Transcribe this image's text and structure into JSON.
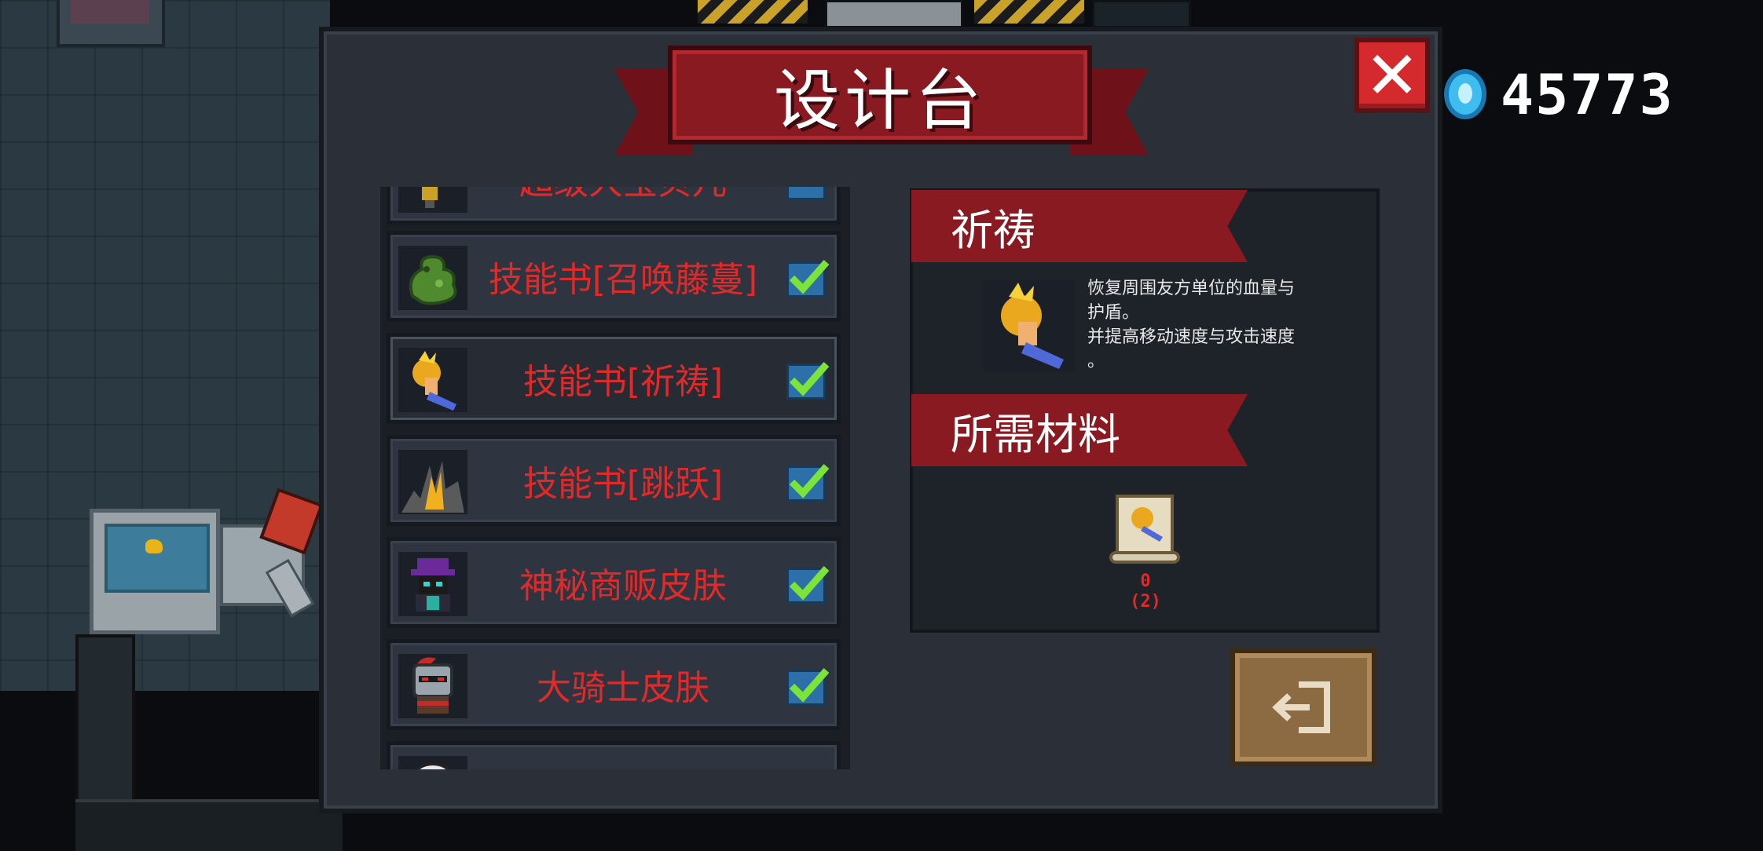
{
  "header": {
    "title": "设计台"
  },
  "currency": {
    "gems": "45773",
    "icon": "gem-icon"
  },
  "list": {
    "partial_top_label": "超级大宝贝儿",
    "items": [
      {
        "label": "技能书[召唤藤蔓]",
        "icon": "vine-dragon-icon",
        "checked": true
      },
      {
        "label": "技能书[祈祷]",
        "icon": "prayer-hand-icon",
        "checked": true,
        "selected": true
      },
      {
        "label": "技能书[跳跃]",
        "icon": "jump-burst-icon",
        "checked": true
      },
      {
        "label": "神秘商贩皮肤",
        "icon": "mystery-merchant-icon",
        "checked": true
      },
      {
        "label": "大骑士皮肤",
        "icon": "knight-helmet-icon",
        "checked": true
      }
    ]
  },
  "detail": {
    "name": "祈祷",
    "description_lines": [
      "恢复周围友方单位的血量与",
      "护盾。",
      "并提高移动速度与攻击速度",
      "。"
    ],
    "materials_header": "所需材料",
    "material": {
      "icon": "skill-scroll-icon",
      "owned": "0",
      "required": "(2)"
    }
  },
  "colors": {
    "accent_red": "#8a1a22",
    "label_red": "#e02a2a",
    "check_blue": "#2d6fa8",
    "check_green": "#7de23a"
  }
}
